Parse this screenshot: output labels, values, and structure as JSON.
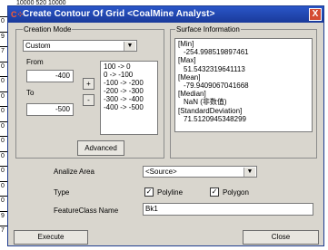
{
  "background": {
    "left_numbers": [
      "0",
      "9",
      "7",
      "0",
      "0",
      "0",
      "0",
      "0",
      "0",
      "0",
      "0",
      "0",
      "0",
      "9",
      "7"
    ],
    "top_fragment": "10000   520    10000"
  },
  "window": {
    "title": "Create Contour Of Grid <CoalMine Analyst>",
    "icon": "app-icon",
    "close_label": "X"
  },
  "creation_mode": {
    "group_label": "Creation Mode",
    "mode_selected": "Custom",
    "from_label": "From",
    "from_value": "-400",
    "to_label": "To",
    "to_value": "-500",
    "add_label": "+",
    "remove_label": "-",
    "ranges": [
      "100 -> 0",
      "0 -> -100",
      "-100 -> -200",
      "-200 -> -300",
      "-300 -> -400",
      "-400 -> -500"
    ],
    "advanced_label": "Advanced"
  },
  "surface_info": {
    "group_label": "Surface Information",
    "lines": [
      {
        "text": "[Min]",
        "indent": false
      },
      {
        "text": "-254.998519897461",
        "indent": true
      },
      {
        "text": "[Max]",
        "indent": false
      },
      {
        "text": "51.5432319641113",
        "indent": true
      },
      {
        "text": "[Mean]",
        "indent": false
      },
      {
        "text": "-79.9409067041668",
        "indent": true
      },
      {
        "text": "[Median]",
        "indent": false
      },
      {
        "text": "NaN (非数值)",
        "indent": true
      },
      {
        "text": "[StandardDeviation]",
        "indent": false
      },
      {
        "text": "71.5120945348299",
        "indent": true
      }
    ]
  },
  "options": {
    "area_label": "Analize Area",
    "area_value": "<Source>",
    "type_label": "Type",
    "polyline_label": "Polyline",
    "polyline_checked": true,
    "polygon_label": "Polygon",
    "polygon_checked": true,
    "fc_label": "FeatureClass Name",
    "fc_value": "Bk1"
  },
  "footer": {
    "execute_label": "Execute",
    "close_label": "Close"
  }
}
